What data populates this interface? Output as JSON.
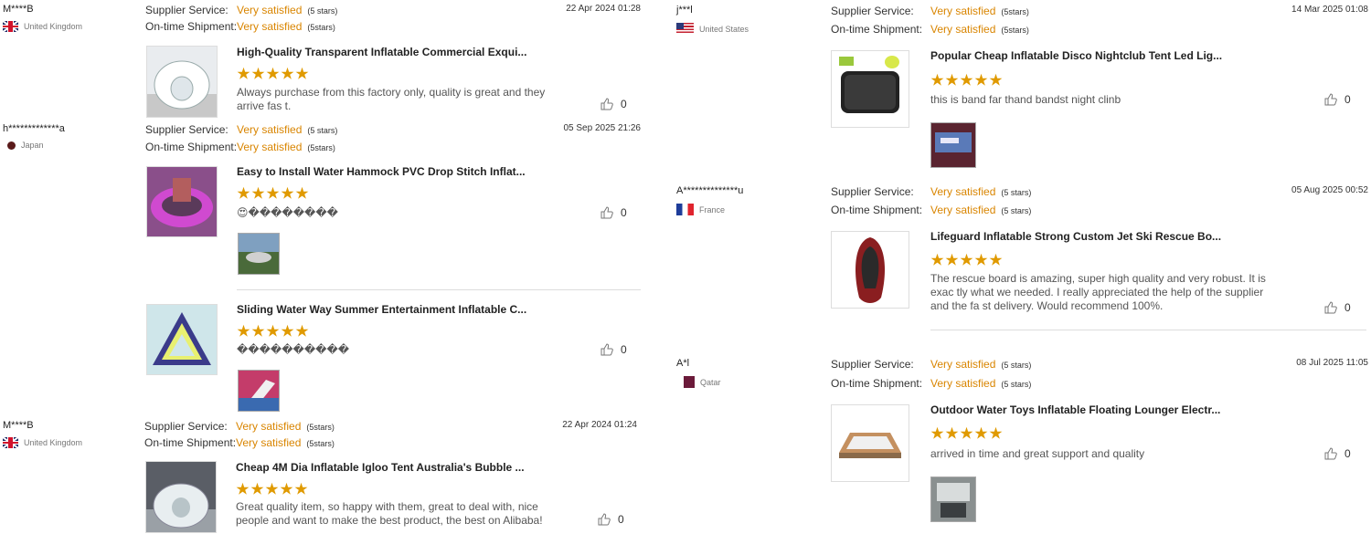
{
  "labels": {
    "supplier_service": "Supplier Service:",
    "ontime_shipment": "On-time Shipment:"
  },
  "reviews": [
    {
      "user": "M****B",
      "country": "United Kingdom",
      "flag_icon": "uk-flag-icon",
      "supplier_value": "Very satisfied",
      "supplier_stars": "(5 stars)",
      "shipment_value": "Very satisfied",
      "shipment_stars": "(5stars)",
      "date": "22 Apr 2024 01:28",
      "product": "High-Quality Transparent Inflatable Commercial Exqui...",
      "rating": 5,
      "comment": "Always purchase from this factory only, quality is great and they arrive fas t.",
      "likes": "0"
    },
    {
      "user": "h*************a",
      "country": "Japan",
      "flag_icon": "japan-flag-icon",
      "supplier_value": "Very satisfied",
      "supplier_stars": "(5 stars)",
      "shipment_value": "Very satisfied",
      "shipment_stars": "(5stars)",
      "date": "05 Sep 2025 21:26",
      "product": "Easy to Install Water Hammock PVC Drop Stitch Inflat...",
      "rating": 5,
      "comment": "😍��������",
      "likes": "0"
    },
    {
      "product": "Sliding Water Way Summer Entertainment Inflatable C...",
      "rating": 5,
      "comment": "����������",
      "likes": "0"
    },
    {
      "user": "M****B",
      "country": "United Kingdom",
      "flag_icon": "uk-flag-icon",
      "supplier_value": "Very satisfied",
      "supplier_stars": "(5stars)",
      "shipment_value": "Very satisfied",
      "shipment_stars": "(5stars)",
      "date": "22 Apr 2024 01:24",
      "product": "Cheap 4M Dia Inflatable Igloo Tent Australia's Bubble ...",
      "rating": 5,
      "comment": "Great quality item, so happy with them, great to deal with, nice people and want to make the best product, the best on Alibaba!",
      "likes": "0"
    },
    {
      "user": "j***l",
      "country": "United States",
      "flag_icon": "us-flag-icon",
      "supplier_value": "Very satisfied",
      "supplier_stars": "(5stars)",
      "shipment_value": "Very satisfied",
      "shipment_stars": "(5stars)",
      "date": "14 Mar 2025 01:08",
      "product": "Popular Cheap Inflatable Disco Nightclub Tent Led Lig...",
      "rating": 5,
      "comment": "this is band far thand bandst night clinb",
      "likes": "0"
    },
    {
      "user": "A**************u",
      "country": "France",
      "flag_icon": "france-flag-icon",
      "supplier_value": "Very satisfied",
      "supplier_stars": "(5 stars)",
      "shipment_value": "Very satisfied",
      "shipment_stars": "(5 stars)",
      "date": "05 Aug 2025 00:52",
      "product": "Lifeguard Inflatable Strong Custom Jet Ski Rescue Bo...",
      "rating": 5,
      "comment": "The rescue board is amazing, super high quality and very robust. It is exac tly what we needed. I really appreciated the help of the supplier and the fa st delivery. Would recommend 100%.",
      "likes": "0"
    },
    {
      "user": "A*l",
      "country": "Qatar",
      "flag_icon": "qatar-flag-icon",
      "supplier_value": "Very satisfied",
      "supplier_stars": "(5 stars)",
      "shipment_value": "Very satisfied",
      "shipment_stars": "(5 stars)",
      "date": "08 Jul 2025 11:05",
      "product": "Outdoor Water Toys Inflatable Floating Lounger Electr...",
      "rating": 5,
      "comment": "arrived in time and great support and quality",
      "likes": "0"
    }
  ],
  "colors": {
    "accent": "#d98500",
    "star": "#e09a00"
  }
}
